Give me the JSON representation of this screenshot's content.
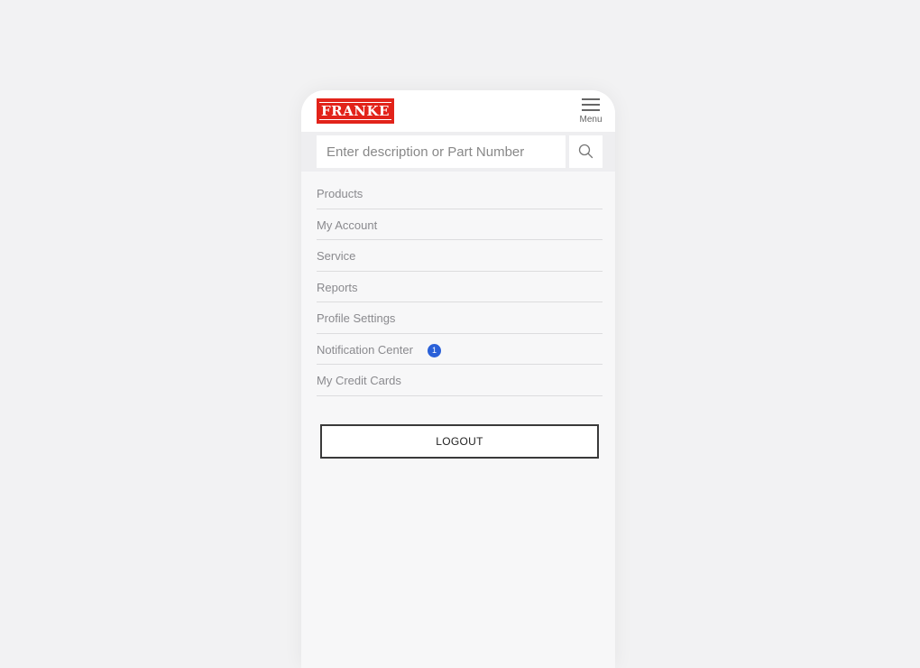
{
  "header": {
    "logo_text": "FRANKE",
    "menu_label": "Menu"
  },
  "search": {
    "placeholder": "Enter description or Part Number",
    "icon": "search-icon"
  },
  "nav": {
    "items": [
      {
        "label": "Products"
      },
      {
        "label": "My Account"
      },
      {
        "label": "Service"
      },
      {
        "label": "Reports"
      },
      {
        "label": "Profile Settings"
      },
      {
        "label": "Notification Center",
        "badge": "1"
      },
      {
        "label": "My Credit Cards"
      }
    ]
  },
  "logout": {
    "label": "LOGOUT"
  },
  "colors": {
    "brand_red": "#e2231a",
    "badge_blue": "#2a60d8",
    "background": "#f2f2f3"
  }
}
